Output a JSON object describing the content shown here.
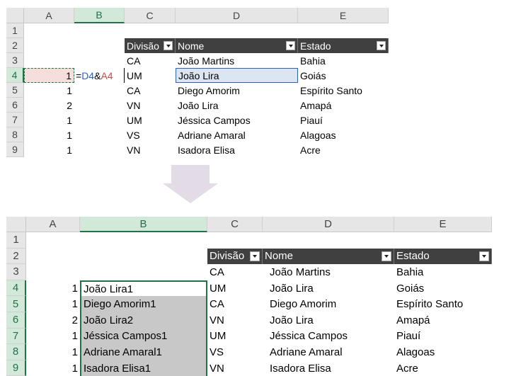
{
  "top": {
    "columns": [
      "A",
      "B",
      "C",
      "D",
      "E"
    ],
    "selected_column": "B",
    "rows": [
      "1",
      "2",
      "3",
      "4",
      "5",
      "6",
      "7",
      "8",
      "9"
    ],
    "selected_row": "4",
    "table_headers": [
      "Divisão",
      "Nome",
      "Estado"
    ],
    "col_a": [
      "",
      "",
      "",
      "1",
      "1",
      "2",
      "1",
      "1",
      "1"
    ],
    "formula": {
      "eq": "=",
      "ref1": "D4",
      "amp": "&",
      "ref2": "A4",
      "ref1_color": "#2f5fbf",
      "ref2_color": "#c0504d"
    },
    "divisao": [
      "CA",
      "UM",
      "CA",
      "VN",
      "UM",
      "VS",
      "VN"
    ],
    "nome": [
      "João Martins",
      "João Lira",
      "Diego Amorim",
      "João Lira",
      "Jéssica Campos",
      "Adriane Amaral",
      "Isadora Elisa"
    ],
    "estado": [
      "Bahia",
      "Goiás",
      "Espírito Santo",
      "Amapá",
      "Piauí",
      "Alagoas",
      "Acre"
    ]
  },
  "bottom": {
    "columns": [
      "A",
      "B",
      "C",
      "D",
      "E"
    ],
    "selected_column": "B",
    "rows": [
      "1",
      "2",
      "3",
      "4",
      "5",
      "6",
      "7",
      "8",
      "9"
    ],
    "selected_rows": [
      "4",
      "5",
      "6",
      "7",
      "8",
      "9"
    ],
    "table_headers": [
      "Divisão",
      "Nome",
      "Estado"
    ],
    "col_a": [
      "",
      "",
      "",
      "1",
      "1",
      "2",
      "1",
      "1",
      "1"
    ],
    "col_b": [
      "",
      "",
      "",
      "João Lira1",
      "Diego Amorim1",
      "João Lira2",
      "Jéssica Campos1",
      "Adriane Amaral1",
      "Isadora Elisa1"
    ],
    "divisao": [
      "CA",
      "UM",
      "CA",
      "VN",
      "UM",
      "VS",
      "VN"
    ],
    "nome": [
      "João Martins",
      "João Lira",
      "Diego Amorim",
      "João Lira",
      "Jéssica Campos",
      "Adriane Amaral",
      "Isadora Elisa"
    ],
    "estado": [
      "Bahia",
      "Goiás",
      "Espírito Santo",
      "Amapá",
      "Piauí",
      "Alagoas",
      "Acre"
    ]
  },
  "colors": {
    "header_dark": "#404040",
    "selection_green": "#217346",
    "selection_fill": "#c8c8c8",
    "arrow": "#e3dbe6"
  }
}
